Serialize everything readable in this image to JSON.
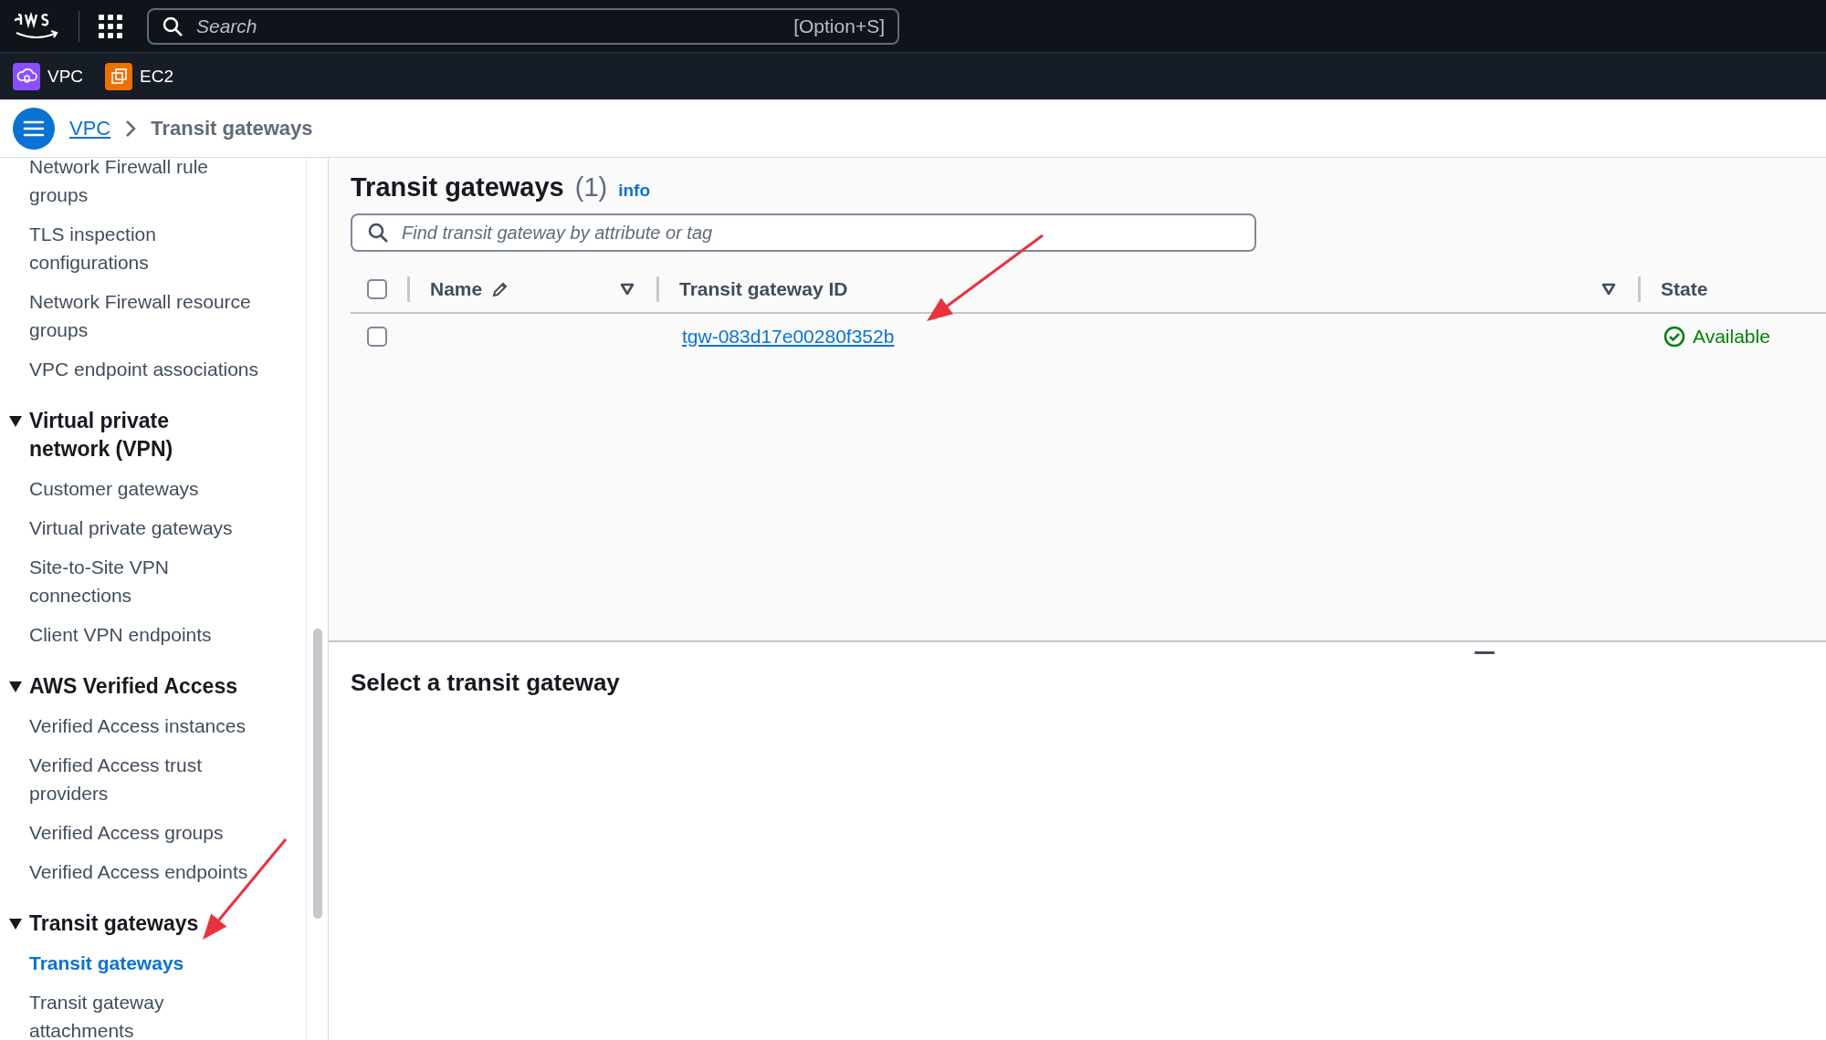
{
  "top_bar": {
    "search": {
      "placeholder": "Search",
      "shortcut": "[Option+S]"
    }
  },
  "favorites": [
    {
      "label": "VPC",
      "color": "#8c4fff"
    },
    {
      "label": "EC2",
      "color": "#ed7100"
    }
  ],
  "breadcrumb": [
    {
      "label": "VPC",
      "kind": "link"
    },
    {
      "label": "Transit gateways",
      "kind": "current"
    }
  ],
  "sidebar": {
    "items": [
      {
        "label": "Network Firewall rule groups",
        "selected": false
      },
      {
        "label": "TLS inspection configurations",
        "selected": false
      },
      {
        "label": "Network Firewall resource groups",
        "selected": false
      },
      {
        "label": "VPC endpoint associations",
        "selected": false
      }
    ],
    "sections": [
      {
        "label": "Virtual private network (VPN)",
        "expanded": true,
        "children": [
          {
            "label": "Customer gateways",
            "selected": false
          },
          {
            "label": "Virtual private gateways",
            "selected": false
          },
          {
            "label": "Site-to-Site VPN connections",
            "selected": false
          },
          {
            "label": "Client VPN endpoints",
            "selected": false
          }
        ]
      },
      {
        "label": "AWS Verified Access",
        "expanded": true,
        "children": [
          {
            "label": "Verified Access instances",
            "selected": false
          },
          {
            "label": "Verified Access trust providers",
            "selected": false
          },
          {
            "label": "Verified Access groups",
            "selected": false
          },
          {
            "label": "Verified Access endpoints",
            "selected": false
          }
        ]
      },
      {
        "label": "Transit gateways",
        "expanded": true,
        "children": [
          {
            "label": "Transit gateways",
            "selected": true
          },
          {
            "label": "Transit gateway attachments",
            "selected": false
          }
        ]
      }
    ]
  },
  "table": {
    "title": "Transit gateways",
    "count": "(1)",
    "info": "info",
    "filter": {
      "placeholder": "Find transit gateway by attribute or tag"
    },
    "all_selected": false,
    "columns": [
      {
        "label": "Name",
        "kind": "editable"
      },
      {
        "label": "Transit gateway ID",
        "kind": "sortable"
      },
      {
        "label": "State",
        "kind": "plain"
      }
    ],
    "rows": [
      {
        "checked": false,
        "id": "tgw-083d17e00280f352b",
        "state": "Available"
      }
    ]
  },
  "details": {
    "title": "Select a transit gateway"
  }
}
